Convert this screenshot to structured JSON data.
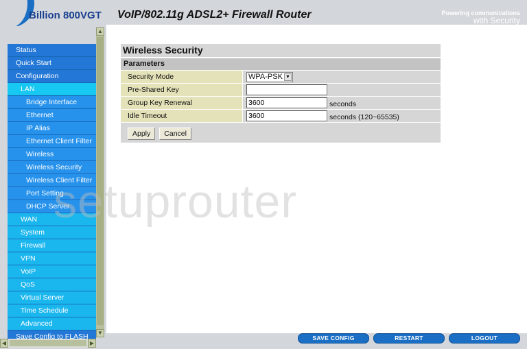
{
  "header": {
    "brand": "Billion 800VGT",
    "product": "VoIP/802.11g ADSL2+ Firewall Router",
    "tagline_line1": "Powering communications",
    "tagline_line2": "with Security"
  },
  "sidebar": {
    "items": [
      {
        "label": "Status",
        "level": "top"
      },
      {
        "label": "Quick Start",
        "level": "top"
      },
      {
        "label": "Configuration",
        "level": "top"
      },
      {
        "label": "LAN",
        "level": "l1"
      },
      {
        "label": "Bridge Interface",
        "level": "l2"
      },
      {
        "label": "Ethernet",
        "level": "l2"
      },
      {
        "label": "IP Alias",
        "level": "l2"
      },
      {
        "label": "Ethernet Client Filter",
        "level": "l2"
      },
      {
        "label": "Wireless",
        "level": "l2"
      },
      {
        "label": "Wireless Security",
        "level": "l2"
      },
      {
        "label": "Wireless Client Filter",
        "level": "l2"
      },
      {
        "label": "Port Setting",
        "level": "l2"
      },
      {
        "label": "DHCP Server",
        "level": "l2"
      },
      {
        "label": "WAN",
        "level": "l1"
      },
      {
        "label": "System",
        "level": "l1"
      },
      {
        "label": "Firewall",
        "level": "l1"
      },
      {
        "label": "VPN",
        "level": "l1"
      },
      {
        "label": "VoIP",
        "level": "l1"
      },
      {
        "label": "QoS",
        "level": "l1"
      },
      {
        "label": "Virtual Server",
        "level": "l1"
      },
      {
        "label": "Time Schedule",
        "level": "l1"
      },
      {
        "label": "Advanced",
        "level": "l1"
      },
      {
        "label": "Save Config to FLASH",
        "level": "top"
      }
    ]
  },
  "panel": {
    "title": "Wireless Security",
    "section": "Parameters",
    "fields": {
      "security_mode": {
        "label": "Security Mode",
        "value": "WPA-PSK"
      },
      "pre_shared_key": {
        "label": "Pre-Shared Key",
        "value": ""
      },
      "group_key_renewal": {
        "label": "Group Key Renewal",
        "value": "3600",
        "suffix": "seconds"
      },
      "idle_timeout": {
        "label": "Idle Timeout",
        "value": "3600",
        "suffix": "seconds (120~65535)"
      }
    },
    "apply_label": "Apply",
    "cancel_label": "Cancel"
  },
  "watermark": "setuprouter",
  "footer": {
    "save_config": "SAVE CONFIG",
    "restart": "RESTART",
    "logout": "LOGOUT"
  },
  "colors": {
    "menu_top": "#2377d6",
    "menu_level1": "#1ab6ee",
    "menu_level2": "#2792ec",
    "footer_button": "#1a6fc4",
    "label_cell": "#e4e2b8"
  }
}
